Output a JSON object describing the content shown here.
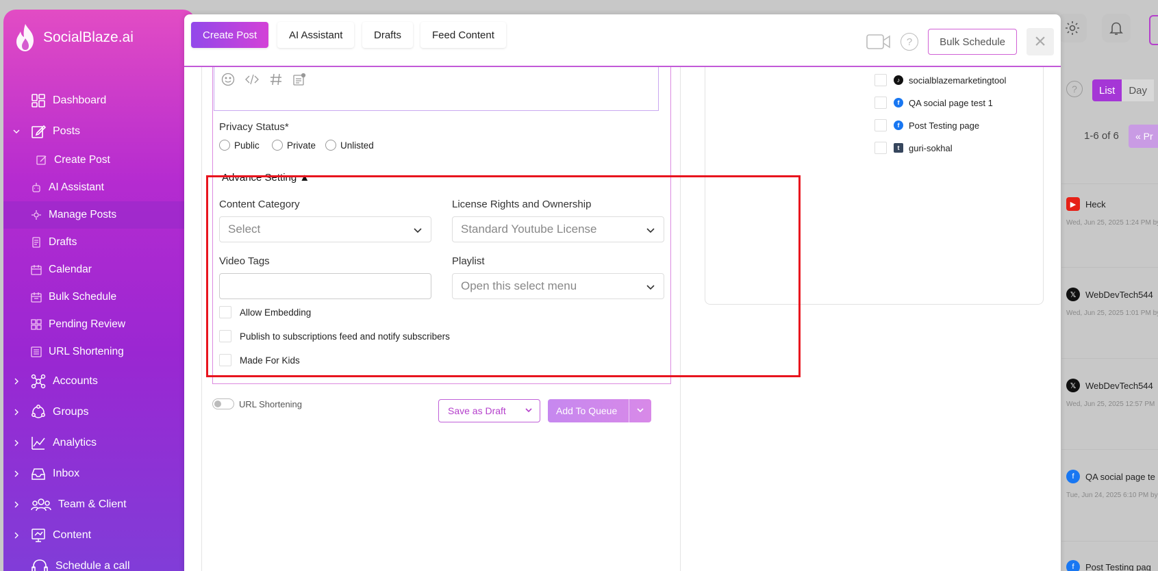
{
  "app": {
    "name": "SocialBlaze.ai"
  },
  "sidebar": {
    "items": [
      {
        "label": "Dashboard",
        "icon": "dashboard-icon"
      },
      {
        "label": "Posts",
        "icon": "edit-icon"
      },
      {
        "label": "Create Post",
        "icon": "create-post-icon"
      },
      {
        "label": "AI Assistant",
        "icon": "ai-assistant-icon"
      },
      {
        "label": "Manage Posts",
        "icon": "manage-posts-icon"
      },
      {
        "label": "Drafts",
        "icon": "drafts-icon"
      },
      {
        "label": "Calendar",
        "icon": "calendar-icon"
      },
      {
        "label": "Bulk Schedule",
        "icon": "bulk-schedule-icon"
      },
      {
        "label": "Pending Review",
        "icon": "pending-review-icon"
      },
      {
        "label": "URL Shortening",
        "icon": "url-shortening-icon"
      },
      {
        "label": "Accounts",
        "icon": "accounts-icon"
      },
      {
        "label": "Groups",
        "icon": "groups-icon"
      },
      {
        "label": "Analytics",
        "icon": "analytics-icon"
      },
      {
        "label": "Inbox",
        "icon": "inbox-icon"
      },
      {
        "label": "Team & Client",
        "icon": "team-icon"
      },
      {
        "label": "Content",
        "icon": "content-icon"
      },
      {
        "label": "Schedule a call",
        "icon": "headset-icon"
      }
    ]
  },
  "modal": {
    "tabs": [
      "Create Post",
      "AI Assistant",
      "Drafts",
      "Feed Content"
    ],
    "bulk_schedule": "Bulk Schedule",
    "privacy": {
      "label": "Privacy Status*",
      "options": [
        "Public",
        "Private",
        "Unlisted"
      ]
    },
    "advance_setting": "Advance Setting ▲",
    "content_category": {
      "label": "Content Category",
      "value": "Select"
    },
    "license": {
      "label": "License Rights and Ownership",
      "value": "Standard Youtube License"
    },
    "video_tags": {
      "label": "Video Tags",
      "value": ""
    },
    "playlist": {
      "label": "Playlist",
      "value": "Open this select menu"
    },
    "checkboxes": [
      "Allow Embedding",
      "Publish to subscriptions feed and notify subscribers",
      "Made For Kids"
    ],
    "url_shortening": "URL Shortening",
    "save_draft": "Save as Draft",
    "add_queue": "Add To Queue",
    "accounts": [
      {
        "name": "socialblazemarketingtool",
        "platform": "tiktok",
        "color": "#111111"
      },
      {
        "name": "QA social page test 1",
        "platform": "facebook",
        "color": "#1877f2"
      },
      {
        "name": "Post Testing page",
        "platform": "facebook",
        "color": "#1877f2"
      },
      {
        "name": "guri-sokhal",
        "platform": "tumblr",
        "color": "#36465d"
      }
    ]
  },
  "background": {
    "list_label": "List",
    "day_label": "Day",
    "pagination": "1-6 of 6",
    "prev_label": "« Pr",
    "feed": [
      {
        "name": "Heck",
        "date": "Wed, Jun 25, 2025 1:24 PM by",
        "platform": "youtube",
        "color": "#e62117"
      },
      {
        "name": "WebDevTech544",
        "date": "Wed, Jun 25, 2025 1:01 PM by",
        "platform": "x",
        "color": "#111111"
      },
      {
        "name": "WebDevTech544",
        "date": "Wed, Jun 25, 2025 12:57 PM",
        "platform": "x",
        "color": "#111111"
      },
      {
        "name": "QA social page te",
        "date": "Tue, Jun 24, 2025 6:10 PM by",
        "platform": "facebook",
        "color": "#1877f2"
      },
      {
        "name": "Post Testing pag",
        "date": "",
        "platform": "facebook",
        "color": "#1877f2"
      }
    ]
  }
}
